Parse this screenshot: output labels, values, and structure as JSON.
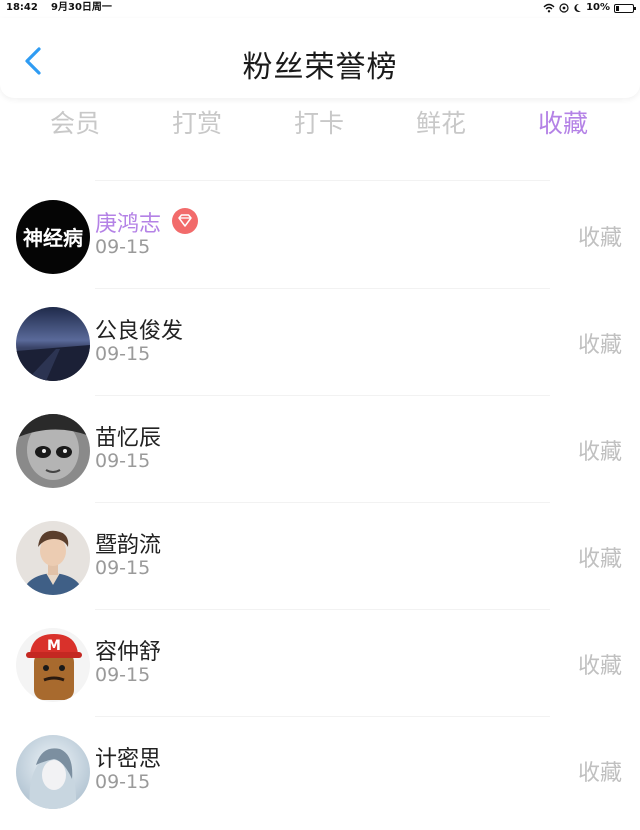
{
  "status_bar": {
    "time": "18:42",
    "date": "9月30日周一",
    "battery": "10%",
    "icons": [
      "wifi-icon",
      "location-icon",
      "moon-icon",
      "battery-icon"
    ]
  },
  "header": {
    "title": "粉丝荣誉榜",
    "back_icon": "chevron-left-icon"
  },
  "tabs": [
    {
      "label": "会员",
      "active": false
    },
    {
      "label": "打赏",
      "active": false
    },
    {
      "label": "打卡",
      "active": false
    },
    {
      "label": "鲜花",
      "active": false
    },
    {
      "label": "收藏",
      "active": true
    }
  ],
  "fans": [
    {
      "name": "庚鸿志",
      "date": "09-15",
      "action": "收藏",
      "badge": "diamond-badge-icon",
      "highlight": true
    },
    {
      "name": "公良俊发",
      "date": "09-15",
      "action": "收藏"
    },
    {
      "name": "苗忆辰",
      "date": "09-15",
      "action": "收藏"
    },
    {
      "name": "暨韵流",
      "date": "09-15",
      "action": "收藏"
    },
    {
      "name": "容仲舒",
      "date": "09-15",
      "action": "收藏"
    },
    {
      "name": "计密思",
      "date": "09-15",
      "action": "收藏"
    }
  ],
  "colors": {
    "accent": "#b482e6",
    "back_icon": "#2f9cf3",
    "badge": "#f26b6b",
    "inactive_tab": "#c8c8c8",
    "muted": "#9a9a9a"
  }
}
